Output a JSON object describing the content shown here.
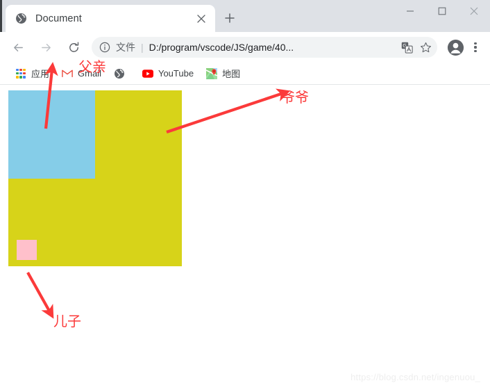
{
  "window": {
    "controls": {
      "minimize": "minimize-button",
      "maximize": "maximize-button",
      "close": "close-button"
    }
  },
  "tabs": [
    {
      "title": "Document",
      "favicon": "globe-icon",
      "close_label": "×",
      "active": true
    }
  ],
  "new_tab_label": "+",
  "toolbar": {
    "back_icon": "back-arrow-icon",
    "forward_icon": "forward-arrow-icon",
    "reload_icon": "reload-icon",
    "omnibox": {
      "info_icon": "info-circle-icon",
      "scheme_label": "文件",
      "separator": "|",
      "url": "D:/program/vscode/JS/game/40...",
      "translate_icon": "translate-icon",
      "bookmark_star_icon": "star-icon"
    },
    "profile_icon": "account-avatar-icon",
    "menu_icon": "three-dot-menu-icon"
  },
  "bookmarks": [
    {
      "label": "应用",
      "icon": "apps-grid-icon"
    },
    {
      "label": "Gmail",
      "icon": "gmail-icon"
    },
    {
      "label": "",
      "icon": "globe-icon"
    },
    {
      "label": "YouTube",
      "icon": "youtube-icon"
    },
    {
      "label": "地图",
      "icon": "google-maps-icon"
    }
  ],
  "page": {
    "boxes": [
      {
        "name": "grandpa-box",
        "color": "#d7d319"
      },
      {
        "name": "father-box",
        "color": "#85cde8"
      },
      {
        "name": "son-box",
        "color": "#ffc0cb"
      }
    ],
    "annotations": [
      {
        "id": "father",
        "label": "父亲",
        "color": "#fb3a3a"
      },
      {
        "id": "grandpa",
        "label": "爷爷",
        "color": "#fb3a3a"
      },
      {
        "id": "son",
        "label": "儿子",
        "color": "#fb3a3a"
      }
    ],
    "watermark": "https://blog.csdn.net/ingenuou_"
  },
  "colors": {
    "yellow": "#d7d319",
    "blue": "#85cde8",
    "pink": "#ffc0cb",
    "annotation_red": "#fb3a3a",
    "tabstrip_bg": "#dee1e6",
    "omnibox_bg": "#f1f3f4"
  }
}
